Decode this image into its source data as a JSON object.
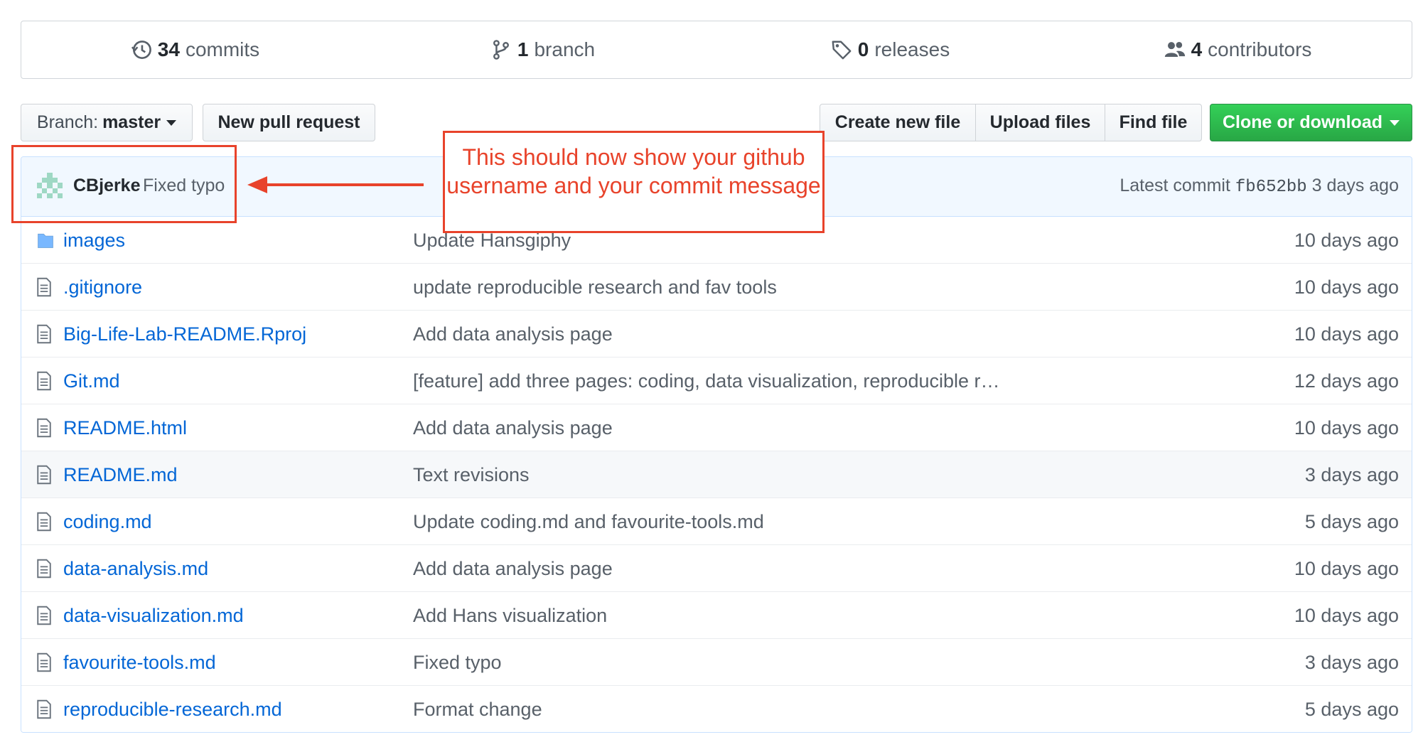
{
  "summary": {
    "commits": {
      "count": "34",
      "label": "commits"
    },
    "branch": {
      "count": "1",
      "label": "branch"
    },
    "releases": {
      "count": "0",
      "label": "releases"
    },
    "contributors": {
      "count": "4",
      "label": "contributors"
    }
  },
  "toolbar": {
    "branch_prefix": "Branch:",
    "branch_name": "master",
    "new_pull_request": "New pull request",
    "create_new_file": "Create new file",
    "upload_files": "Upload files",
    "find_file": "Find file",
    "clone_or_download": "Clone or download"
  },
  "latest_commit": {
    "author": "CBjerke",
    "message": "Fixed typo",
    "prefix": "Latest commit",
    "sha": "fb652bb",
    "age": "3 days ago"
  },
  "files": [
    {
      "type": "folder",
      "name": "images",
      "message": "Update Hansgiphy",
      "age": "10 days ago"
    },
    {
      "type": "file",
      "name": ".gitignore",
      "message": "update reproducible research and fav tools",
      "age": "10 days ago"
    },
    {
      "type": "file",
      "name": "Big-Life-Lab-README.Rproj",
      "message": "Add data analysis page",
      "age": "10 days ago"
    },
    {
      "type": "file",
      "name": "Git.md",
      "message": "[feature] add three pages: coding, data visualization, reproducible r…",
      "age": "12 days ago"
    },
    {
      "type": "file",
      "name": "README.html",
      "message": "Add data analysis page",
      "age": "10 days ago"
    },
    {
      "type": "file",
      "name": "README.md",
      "message": "Text revisions",
      "age": "3 days ago"
    },
    {
      "type": "file",
      "name": "coding.md",
      "message": "Update coding.md and favourite-tools.md",
      "age": "5 days ago"
    },
    {
      "type": "file",
      "name": "data-analysis.md",
      "message": "Add data analysis page",
      "age": "10 days ago"
    },
    {
      "type": "file",
      "name": "data-visualization.md",
      "message": "Add Hans visualization",
      "age": "10 days ago"
    },
    {
      "type": "file",
      "name": "favourite-tools.md",
      "message": "Fixed typo",
      "age": "3 days ago"
    },
    {
      "type": "file",
      "name": "reproducible-research.md",
      "message": "Format change",
      "age": "5 days ago"
    }
  ],
  "annotation": {
    "note": "This should now show your github username and your commit message",
    "color": "#e8432b"
  },
  "colors": {
    "link": "#0366d6",
    "green_button": "#28a745",
    "commit_bar": "#f1f8ff"
  }
}
